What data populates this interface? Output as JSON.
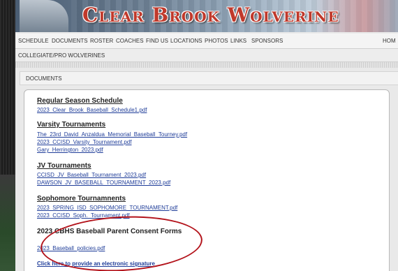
{
  "header": {
    "title": "Clear Brook Wolverine"
  },
  "nav": {
    "items": [
      "SCHEDULE",
      "DOCUMENTS",
      "ROSTER",
      "COACHES",
      "FIND US",
      "LOCATIONS",
      "PHOTOS",
      "LINKS",
      "SPONSORS"
    ],
    "home": "HOM",
    "row2": [
      "COLLEGIATE/PRO WOLVERINES"
    ]
  },
  "documents": {
    "header": "DOCUMENTS",
    "sections": [
      {
        "title": "Regular Season Schedule",
        "links": [
          "2023_Clear_Brook_Baseball_Schedule1.pdf"
        ]
      },
      {
        "title": "Varsity Tournaments",
        "links": [
          "The_23rd_David_Anzaldua_Memorial_Baseball_Tourney.pdf",
          "2023_CCISD_Varsity_Tournament.pdf",
          "Gary_Herrington_2023.pdf"
        ]
      },
      {
        "title": "JV Tournaments",
        "links": [
          "CCISD_JV_Baseball_Tournament_2023.pdf",
          "DAWSON_JV_BASEBALL_TOURNAMENT_2023.pdf"
        ]
      },
      {
        "title": "Sophomore Tournamnents",
        "links": [
          "2023_SPRING_ISD_SOPHOMORE_TOURNAMENT.pdf",
          "2023_CCISD_Soph._Tournament.pdf"
        ]
      },
      {
        "title": "2023 CBHS Baseball Parent Consent Forms",
        "links": [
          "2023_Baseball_policies.pdf"
        ]
      }
    ],
    "signature_link": "Click here to provide an electronic signature"
  }
}
